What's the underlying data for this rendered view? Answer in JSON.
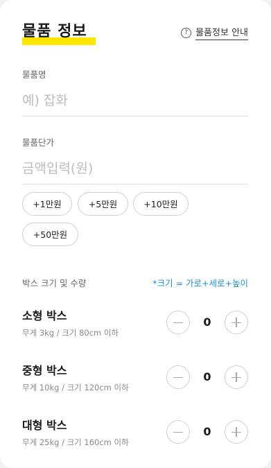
{
  "header": {
    "title": "물품 정보",
    "info_icon": "question-circle-icon",
    "info_link": "물품정보 안내"
  },
  "item_name": {
    "label": "물품명",
    "placeholder": "예) 잡화"
  },
  "item_price": {
    "label": "물품단가",
    "placeholder": "금액입력(원)"
  },
  "quick_amounts": [
    "+1만원",
    "+5만원",
    "+10만원",
    "+50만원"
  ],
  "boxes": {
    "label": "박스 크기 및 수량",
    "note": "*크기 = 가로+세로+높이",
    "items": [
      {
        "name": "소형 박스",
        "desc": "무게 3kg / 크기 80cm 이하",
        "count": "0"
      },
      {
        "name": "중형 박스",
        "desc": "무게 10kg / 크기 120cm 이하",
        "count": "0"
      },
      {
        "name": "대형 박스",
        "desc": "무게 25kg / 크기 160cm 이하",
        "count": "0"
      }
    ]
  },
  "colors": {
    "highlight": "#ffe600",
    "accent": "#1a8fd6"
  }
}
